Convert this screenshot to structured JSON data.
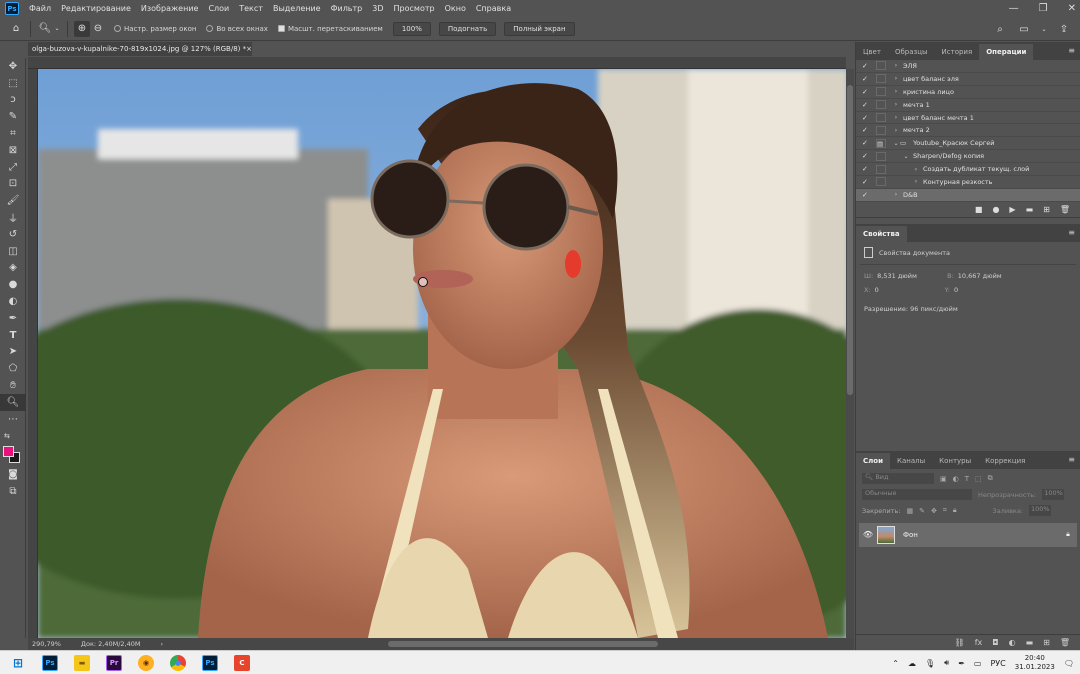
{
  "app": {
    "logo_text": "Ps",
    "menu": [
      "Файл",
      "Редактирование",
      "Изображение",
      "Слои",
      "Текст",
      "Выделение",
      "Фильтр",
      "3D",
      "Просмотр",
      "Окно",
      "Справка"
    ]
  },
  "options_bar": {
    "resize_windows": "Настр. размер окон",
    "all_windows": "Во всех окнах",
    "scrubby_zoom": "Масшт. перетаскиванием",
    "zoom_value": "100%",
    "fit_button": "Подогнать",
    "fullscreen_button": "Полный экран"
  },
  "document": {
    "tab_title": "olga-buzova-v-kupalnike-70-819x1024.jpg @ 127% (RGB/8) *",
    "close": "×"
  },
  "status": {
    "zoom": "290,79%",
    "doc_size": "Док: 2,40M/2,40M",
    "arrow": "›"
  },
  "panels": {
    "top_tabs": [
      "Цвет",
      "Образцы",
      "История",
      "Операции"
    ],
    "actions": [
      {
        "label": "ЭЛЯ",
        "indent": 0,
        "type": "set"
      },
      {
        "label": "цвет баланс эля",
        "indent": 0,
        "type": "set"
      },
      {
        "label": "кристина лицо",
        "indent": 0,
        "type": "set"
      },
      {
        "label": "мечта 1",
        "indent": 0,
        "type": "set"
      },
      {
        "label": "цвет баланс мечта 1",
        "indent": 0,
        "type": "set"
      },
      {
        "label": "мечта 2",
        "indent": 0,
        "type": "set"
      },
      {
        "label": "Youtube_Красюк Сергей",
        "indent": 0,
        "type": "folder"
      },
      {
        "label": "Sharpen/Defog копия",
        "indent": 1,
        "type": "open"
      },
      {
        "label": "Создать дубликат текущ. слой",
        "indent": 2,
        "type": "step"
      },
      {
        "label": "Контурная резкость",
        "indent": 2,
        "type": "step"
      },
      {
        "label": "D&B",
        "indent": 0,
        "type": "set"
      }
    ],
    "properties": {
      "tab": "Свойства",
      "doc_props": "Свойства документа",
      "width_label": "Ш:",
      "width_value": "8,531 дюйм",
      "height_label": "В:",
      "height_value": "10,667 дюйм",
      "x_label": "X:",
      "x_value": "0",
      "y_label": "Y:",
      "y_value": "0",
      "resolution": "Разрешение: 96 пикс/дюйм"
    },
    "layer_tabs": [
      "Слои",
      "Каналы",
      "Контуры",
      "Коррекция"
    ],
    "layers": {
      "search_placeholder": "Вид",
      "blend_mode": "Обычные",
      "opacity_label": "Непрозрачность:",
      "opacity_value": "100%",
      "lock_label": "Закрепить:",
      "fill_label": "Заливка:",
      "fill_value": "100%",
      "background_layer": "Фон"
    }
  },
  "taskbar": {
    "lang": "РУС",
    "time": "20:40",
    "date": "31.01.2023"
  },
  "colors": {
    "foreground": "#e8107a",
    "background": "#1a1a1a",
    "ps_blue": "#31a8ff"
  }
}
